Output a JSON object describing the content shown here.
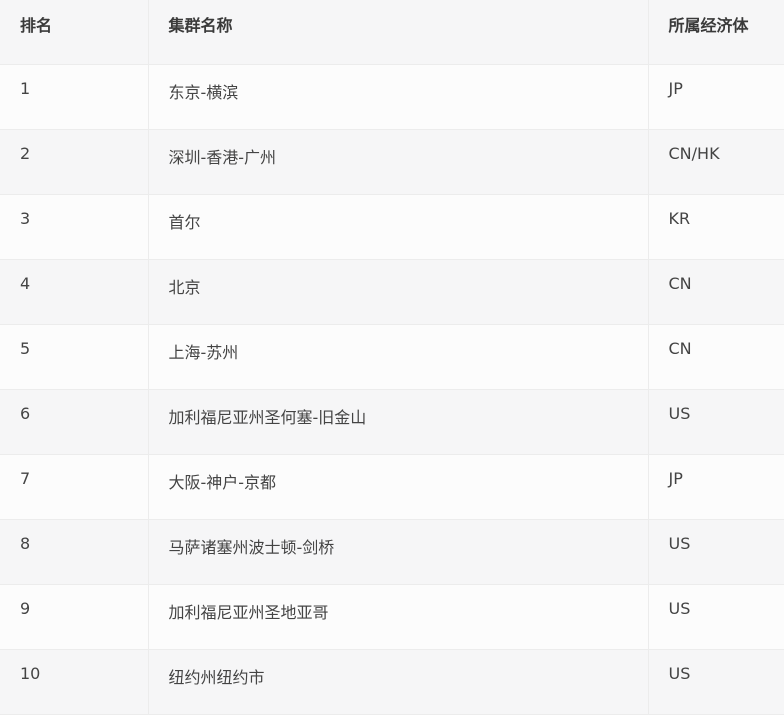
{
  "table": {
    "headers": [
      "排名",
      "集群名称",
      "所属经济体"
    ],
    "rows": [
      {
        "rank": "1",
        "name": "东京-横滨",
        "economy": "JP"
      },
      {
        "rank": "2",
        "name": "深圳-香港-广州",
        "economy": "CN/HK"
      },
      {
        "rank": "3",
        "name": "首尔",
        "economy": "KR"
      },
      {
        "rank": "4",
        "name": "北京",
        "economy": "CN"
      },
      {
        "rank": "5",
        "name": "上海-苏州",
        "economy": "CN"
      },
      {
        "rank": "6",
        "name": "加利福尼亚州圣何塞-旧金山",
        "economy": "US"
      },
      {
        "rank": "7",
        "name": "大阪-神户-京都",
        "economy": "JP"
      },
      {
        "rank": "8",
        "name": "马萨诸塞州波士顿-剑桥",
        "economy": "US"
      },
      {
        "rank": "9",
        "name": "加利福尼亚州圣地亚哥",
        "economy": "US"
      },
      {
        "rank": "10",
        "name": "纽约州纽约市",
        "economy": "US"
      }
    ]
  }
}
